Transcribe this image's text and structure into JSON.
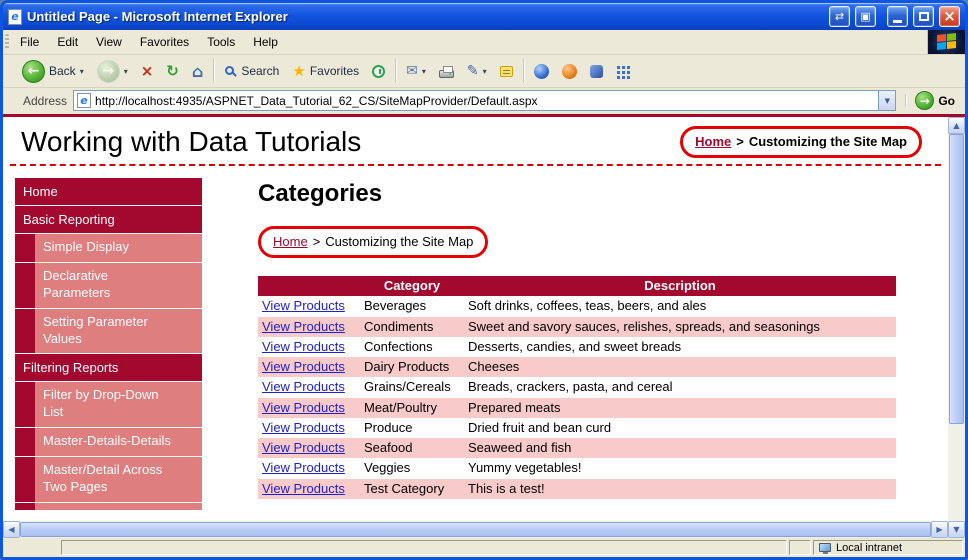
{
  "titlebar": {
    "title": "Untitled Page - Microsoft Internet Explorer"
  },
  "menubar": {
    "items": [
      "File",
      "Edit",
      "View",
      "Favorites",
      "Tools",
      "Help"
    ]
  },
  "toolbar": {
    "back_label": "Back",
    "search_label": "Search",
    "favorites_label": "Favorites"
  },
  "addressbar": {
    "label": "Address",
    "url": "http://localhost:4935/ASPNET_Data_Tutorial_62_CS/SiteMapProvider/Default.aspx",
    "go_label": "Go"
  },
  "icons": {
    "ie_e": "e",
    "titlebar_arrows": "⇄",
    "titlebar_window": "▣",
    "close": "×",
    "chevron_down": "▾",
    "back_arrow": "←",
    "forward_arrow": "→",
    "stop_x": "×",
    "refresh": "↻",
    "home": "⌂",
    "star": "★",
    "mail": "✉",
    "edit_pencil": "✎",
    "combo_down": "▼",
    "go_arrow": "→",
    "arrow_up": "▲",
    "arrow_down": "▼",
    "arrow_left": "◀",
    "arrow_right": "▶"
  },
  "page": {
    "title": "Working with Data Tutorials",
    "top_breadcrumb": {
      "home": "Home",
      "sep": ">",
      "current": "Customizing the Site Map"
    },
    "sidebar": {
      "items": [
        {
          "label": "Home"
        },
        {
          "label": "Basic Reporting"
        },
        {
          "label": "Simple Display"
        },
        {
          "label": "Declarative Parameters"
        },
        {
          "label": "Setting Parameter Values"
        },
        {
          "label": "Filtering Reports"
        },
        {
          "label": "Filter by Drop-Down List"
        },
        {
          "label": "Master-Details-Details"
        },
        {
          "label": "Master/Detail Across Two Pages"
        }
      ]
    },
    "main": {
      "heading": "Categories",
      "breadcrumb": {
        "home": "Home",
        "sep": ">",
        "current": "Customizing the Site Map"
      },
      "table": {
        "columns": [
          "",
          "Category",
          "Description"
        ],
        "rows": [
          {
            "link": "View Products",
            "category": "Beverages",
            "description": "Soft drinks, coffees, teas, beers, and ales"
          },
          {
            "link": "View Products",
            "category": "Condiments",
            "description": "Sweet and savory sauces, relishes, spreads, and seasonings"
          },
          {
            "link": "View Products",
            "category": "Confections",
            "description": "Desserts, candies, and sweet breads"
          },
          {
            "link": "View Products",
            "category": "Dairy Products",
            "description": "Cheeses"
          },
          {
            "link": "View Products",
            "category": "Grains/Cereals",
            "description": "Breads, crackers, pasta, and cereal"
          },
          {
            "link": "View Products",
            "category": "Meat/Poultry",
            "description": "Prepared meats"
          },
          {
            "link": "View Products",
            "category": "Produce",
            "description": "Dried fruit and bean curd"
          },
          {
            "link": "View Products",
            "category": "Seafood",
            "description": "Seaweed and fish"
          },
          {
            "link": "View Products",
            "category": "Veggies",
            "description": "Yummy vegetables!"
          },
          {
            "link": "View Products",
            "category": "Test Category",
            "description": "This is a test!"
          }
        ]
      }
    }
  },
  "statusbar": {
    "zone": "Local intranet"
  },
  "colors": {
    "maroon": "#a3082f",
    "sidebar_pink": "#df7e7e",
    "row_pink": "#f8caca",
    "annotation_red": "#e60000",
    "link_blue": "#2121cc",
    "titlebar_blue": "#1255df",
    "chrome_tan": "#ece9d8"
  }
}
